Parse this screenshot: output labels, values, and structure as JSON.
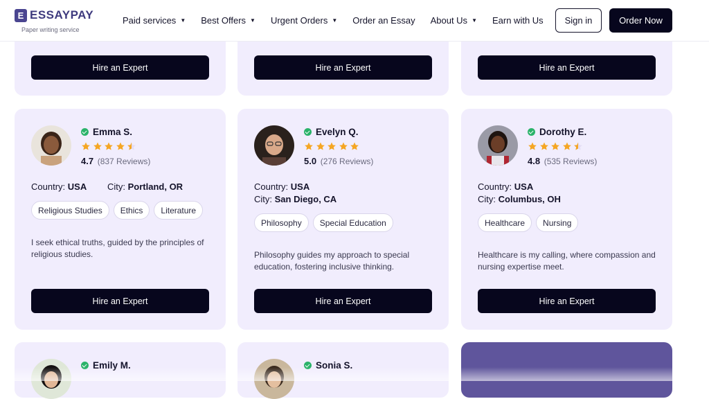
{
  "header": {
    "logo_mark": "E",
    "logo_text": "ESSAYPAY",
    "logo_sub": "Paper writing service",
    "nav": [
      {
        "label": "Paid services",
        "caret": "▼"
      },
      {
        "label": "Best Offers",
        "caret": "▼"
      },
      {
        "label": "Urgent Orders",
        "caret": "▼"
      },
      {
        "label": "Order an Essay",
        "caret": ""
      },
      {
        "label": "About Us",
        "caret": "▼"
      },
      {
        "label": "Earn with Us",
        "caret": ""
      }
    ],
    "sign_in": "Sign in",
    "order_now": "Order Now"
  },
  "hire_label": "Hire an Expert",
  "labels": {
    "country": "Country:",
    "city": "City:"
  },
  "experts": [
    {
      "name": "Emma S.",
      "rating": "4.7",
      "reviews": "(837 Reviews)",
      "stars": 4.5,
      "country": "USA",
      "city": "Portland, OR",
      "tags": [
        "Religious Studies",
        "Ethics",
        "Literature"
      ],
      "description": "I seek ethical truths, guided by the principles of religious studies."
    },
    {
      "name": "Evelyn Q.",
      "rating": "5.0",
      "reviews": "(276 Reviews)",
      "stars": 5,
      "country": "USA",
      "city": "San Diego, CA",
      "tags": [
        "Philosophy",
        "Special Education"
      ],
      "description": "Philosophy guides my approach to special education, fostering inclusive thinking."
    },
    {
      "name": "Dorothy E.",
      "rating": "4.8",
      "reviews": "(535 Reviews)",
      "stars": 4.5,
      "country": "USA",
      "city": "Columbus, OH",
      "tags": [
        "Healthcare",
        "Nursing"
      ],
      "description": "Healthcare is my calling, where compassion and nursing expertise meet."
    },
    {
      "name": "Emily M."
    },
    {
      "name": "Sonia S."
    }
  ],
  "colors": {
    "accent": "#07061d",
    "card_bg": "#f1edfd",
    "star": "#f5a623",
    "verified": "#2bb36a",
    "promo": "#5f559c"
  }
}
